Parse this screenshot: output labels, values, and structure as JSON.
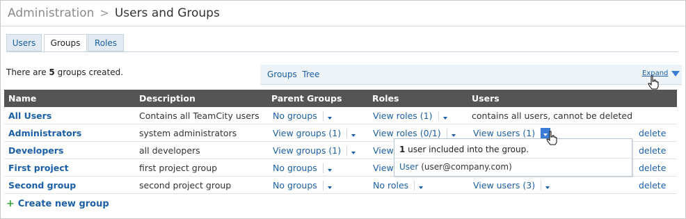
{
  "breadcrumb": {
    "parent": "Administration",
    "current": "Users and Groups"
  },
  "tabs": [
    {
      "label": "Users"
    },
    {
      "label": "Groups"
    },
    {
      "label": "Roles"
    }
  ],
  "summary": {
    "prefix": "There are ",
    "count": "5",
    "suffix": " groups created."
  },
  "groups_tree": {
    "title": "Groups  Tree",
    "expand_label": "Expand"
  },
  "table": {
    "headers": {
      "name": "Name",
      "description": "Description",
      "parent_groups": "Parent Groups",
      "roles": "Roles",
      "users": "Users"
    },
    "rows": [
      {
        "name": "All Users",
        "description": "Contains all TeamCity users",
        "parent_groups": "No groups",
        "roles": "View roles (1)",
        "users": "contains all users, cannot be deleted",
        "action": ""
      },
      {
        "name": "Administrators",
        "description": "system administrators",
        "parent_groups": "View groups (1)",
        "roles": "View roles (0/1)",
        "users": "View users (1)",
        "action": "delete"
      },
      {
        "name": "Developers",
        "description": "all developers",
        "parent_groups": "View groups (1)",
        "roles": "View",
        "users": "",
        "action": "delete"
      },
      {
        "name": "First project",
        "description": "first project group",
        "parent_groups": "No groups",
        "roles": "View",
        "users": "",
        "action": "delete"
      },
      {
        "name": "Second group",
        "description": "second project group",
        "parent_groups": "No groups",
        "roles": "No roles",
        "users": "View users (3)",
        "action": "delete"
      }
    ]
  },
  "popup": {
    "count": "1",
    "text": " user included into the group.",
    "user_name": "User",
    "user_email": "(user@company.com)"
  },
  "create_group": {
    "label": "Create new group"
  },
  "colors": {
    "link": "#1b5fa8",
    "header_bg": "#555555",
    "accent": "#3a7bd5",
    "add_icon": "#3aa43a"
  }
}
